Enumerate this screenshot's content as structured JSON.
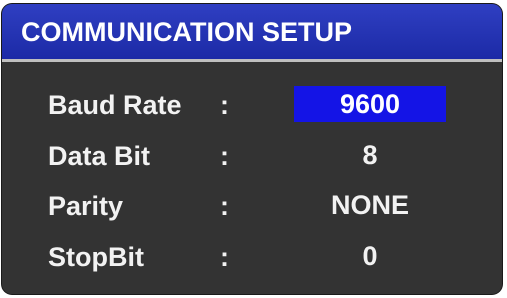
{
  "dialog": {
    "title": "COMMUNICATION SETUP"
  },
  "colors": {
    "title_bar": "#1f2db0",
    "panel_bg": "#333333",
    "selection": "#1414e6",
    "text": "#f2f2f2"
  },
  "settings": [
    {
      "label": "Baud Rate",
      "separator": ":",
      "value": "9600",
      "selected": true
    },
    {
      "label": "Data Bit",
      "separator": ":",
      "value": "8",
      "selected": false
    },
    {
      "label": "Parity",
      "separator": ":",
      "value": "NONE",
      "selected": false
    },
    {
      "label": "StopBit",
      "separator": ":",
      "value": "0",
      "selected": false
    }
  ]
}
